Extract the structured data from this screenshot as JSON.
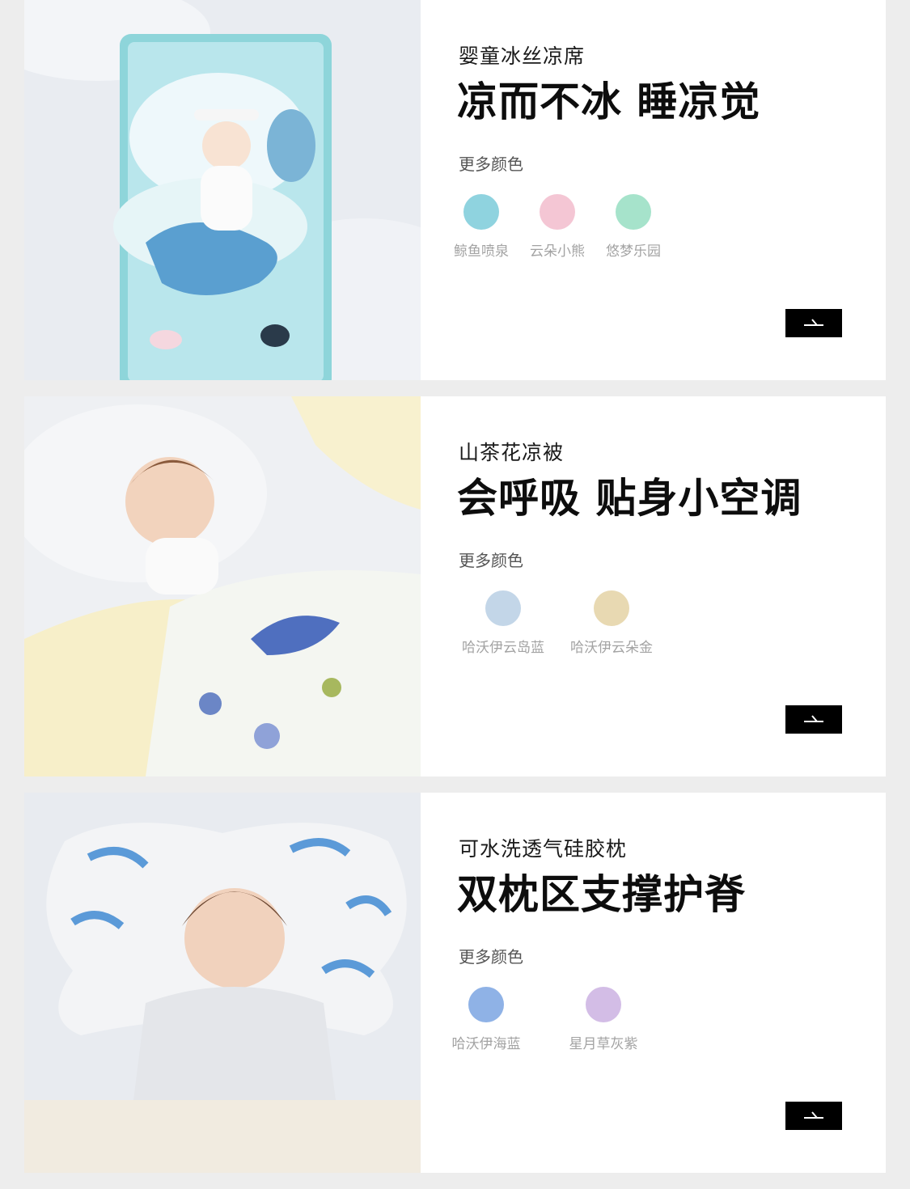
{
  "cards": [
    {
      "product": "婴童冰丝凉席",
      "headline": "凉而不冰 睡凉觉",
      "more_colors": "更多颜色",
      "swatches": [
        {
          "label": "鲸鱼喷泉",
          "color": "#8fd3df"
        },
        {
          "label": "云朵小熊",
          "color": "#f4c6d4"
        },
        {
          "label": "悠梦乐园",
          "color": "#a6e3cb"
        }
      ],
      "arrow_icon": "arrow-right-icon"
    },
    {
      "product": "山茶花凉被",
      "headline": "会呼吸 贴身小空调",
      "more_colors": "更多颜色",
      "swatches": [
        {
          "label": "哈沃伊云岛蓝",
          "color": "#c3d6e8"
        },
        {
          "label": "哈沃伊云朵金",
          "color": "#e8d9b2"
        }
      ],
      "arrow_icon": "arrow-right-icon"
    },
    {
      "product": "可水洗透气硅胶枕",
      "headline": "双枕区支撑护脊",
      "more_colors": "更多颜色",
      "swatches": [
        {
          "label": "哈沃伊海蓝",
          "color": "#8fb2e6"
        },
        {
          "label": "星月草灰紫",
          "color": "#d3bde6"
        }
      ],
      "arrow_icon": "arrow-right-icon"
    }
  ]
}
